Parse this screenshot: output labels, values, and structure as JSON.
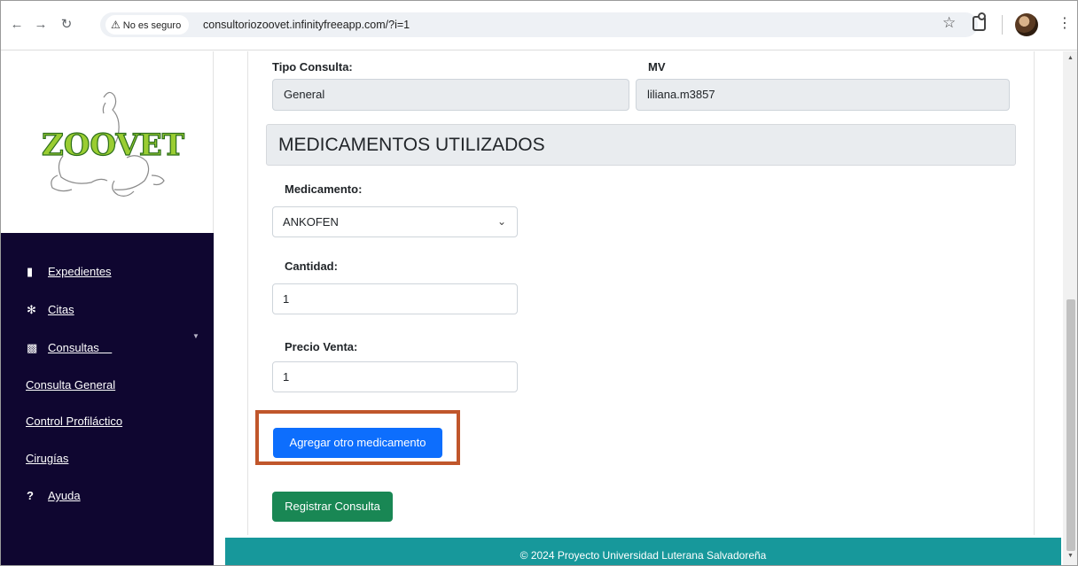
{
  "browser": {
    "security_label": "No es seguro",
    "url": "consultoriozoovet.infinityfreeapp.com/?i=1"
  },
  "sidebar": {
    "logo_text": "ZOOVET",
    "items": [
      {
        "label": "Expedientes",
        "icon": "clipboard-icon"
      },
      {
        "label": "Citas",
        "icon": "puzzle-icon"
      },
      {
        "label": "Consultas",
        "icon": "bar-chart-icon"
      }
    ],
    "subitems": [
      {
        "label": "Consulta General"
      },
      {
        "label": "Control Profiláctico"
      },
      {
        "label": "Cirugías"
      }
    ],
    "help": {
      "label": "Ayuda",
      "icon": "question-circle-icon"
    }
  },
  "form": {
    "tipo_consulta": {
      "label": "Tipo Consulta:",
      "value": "General"
    },
    "mv": {
      "label": "MV",
      "value": "liliana.m3857"
    },
    "section_title": "MEDICAMENTOS UTILIZADOS",
    "medicamento": {
      "label": "Medicamento:",
      "value": "ANKOFEN"
    },
    "cantidad": {
      "label": "Cantidad:",
      "value": "1"
    },
    "precio_venta": {
      "label": "Precio Venta:",
      "value": "1"
    },
    "add_button": "Agregar otro medicamento",
    "submit_button": "Registrar Consulta"
  },
  "footer": {
    "text": "© 2024 Proyecto Universidad Luterana Salvadoreña"
  },
  "colors": {
    "sidebar": "#0f0630",
    "primary": "#0d6efd",
    "success": "#198754",
    "footer": "#17989b",
    "highlight": "#c0562b"
  }
}
